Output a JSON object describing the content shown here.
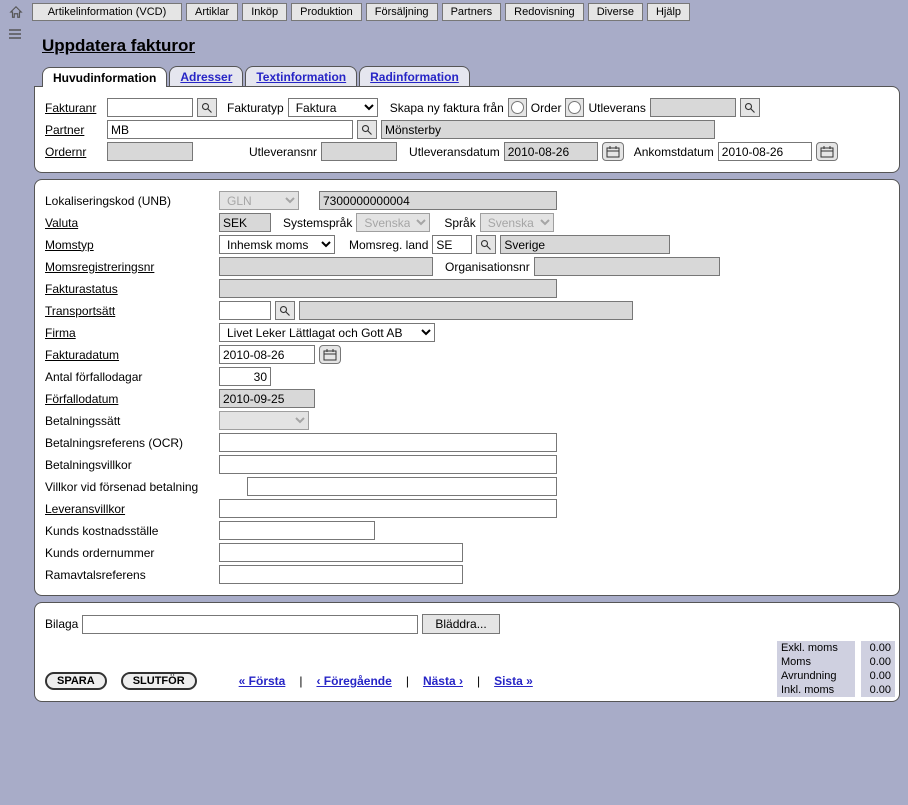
{
  "menu": {
    "items": [
      "Artikelinformation (VCD)",
      "Artiklar",
      "Inköp",
      "Produktion",
      "Försäljning",
      "Partners",
      "Redovisning",
      "Diverse",
      "Hjälp"
    ]
  },
  "title": "Uppdatera fakturor",
  "tabs": [
    "Huvudinformation",
    "Adresser",
    "Textinformation",
    "Radinformation"
  ],
  "hdr": {
    "fakturanr_label": "Fakturanr",
    "fakturanr": "",
    "fakturatyp_label": "Fakturatyp",
    "fakturatyp": "Faktura",
    "skapa_label": "Skapa ny faktura från",
    "radio_order": "Order",
    "radio_utlev": "Utleverans",
    "skapa_val": "",
    "partner_label": "Partner",
    "partner_code": "MB",
    "partner_name": "Mönsterby",
    "ordernr_label": "Ordernr",
    "ordernr": "",
    "utlevnr_label": "Utleveransnr",
    "utlevnr": "",
    "utlevdatum_label": "Utleveransdatum",
    "utlevdatum": "2010-08-26",
    "ankomst_label": "Ankomstdatum",
    "ankomst": "2010-08-26"
  },
  "main": {
    "lokaliseringskod_label": "Lokaliseringskod (UNB)",
    "lok_typ": "GLN",
    "lok_val": "7300000000004",
    "valuta_label": "Valuta",
    "valuta": "SEK",
    "systemsprak_label": "Systemspråk",
    "systemsprak": "Svenska",
    "sprak_label": "Språk",
    "sprak": "Svenska",
    "momstyp_label": "Momstyp",
    "momstyp": "Inhemsk moms",
    "momsreg_land_label": "Momsreg. land",
    "momsreg_land_code": "SE",
    "momsreg_land_name": "Sverige",
    "momsregnr_label": "Momsregistreringsnr",
    "momsregnr": "",
    "orgnr_label": "Organisationsnr",
    "orgnr": "",
    "fakturastatus_label": "Fakturastatus",
    "fakturastatus": "",
    "transportsatt_label": "Transportsätt",
    "transportsatt_code": "",
    "transportsatt_name": "",
    "firma_label": "Firma",
    "firma": "Livet Leker Lättlagat och Gott AB",
    "fakturadatum_label": "Fakturadatum",
    "fakturadatum": "2010-08-26",
    "antal_forf_label": "Antal förfallodagar",
    "antal_forf": "30",
    "forfallodatum_label": "Förfallodatum",
    "forfallodatum": "2010-09-25",
    "betalningssatt_label": "Betalningssätt",
    "betalningssatt": "",
    "ocr_label": "Betalningsreferens (OCR)",
    "ocr": "",
    "betalningsvillkor_label": "Betalningsvillkor",
    "betalningsvillkor": "",
    "forsenad_label": "Villkor vid försenad betalning",
    "forsenad": "",
    "leveransvillkor_label": "Leveransvillkor",
    "leveransvillkor": "",
    "kunds_kost_label": "Kunds kostnadsställe",
    "kunds_kost": "",
    "kunds_order_label": "Kunds ordernummer",
    "kunds_order": "",
    "ramavtal_label": "Ramavtalsreferens",
    "ramavtal": ""
  },
  "bottom": {
    "bilaga_label": "Bilaga",
    "bilaga": "",
    "browse": "Bläddra...",
    "spara": "SPARA",
    "slutfor": "SLUTFÖR",
    "nav_first": "« Första",
    "nav_prev": "‹ Föregående",
    "nav_next": "Nästa ›",
    "nav_last": "Sista »",
    "sep": " | "
  },
  "totals": {
    "exkl_label": "Exkl. moms",
    "exkl": "0.00",
    "moms_label": "Moms",
    "moms": "0.00",
    "avr_label": "Avrundning",
    "avr": "0.00",
    "inkl_label": "Inkl. moms",
    "inkl": "0.00"
  }
}
